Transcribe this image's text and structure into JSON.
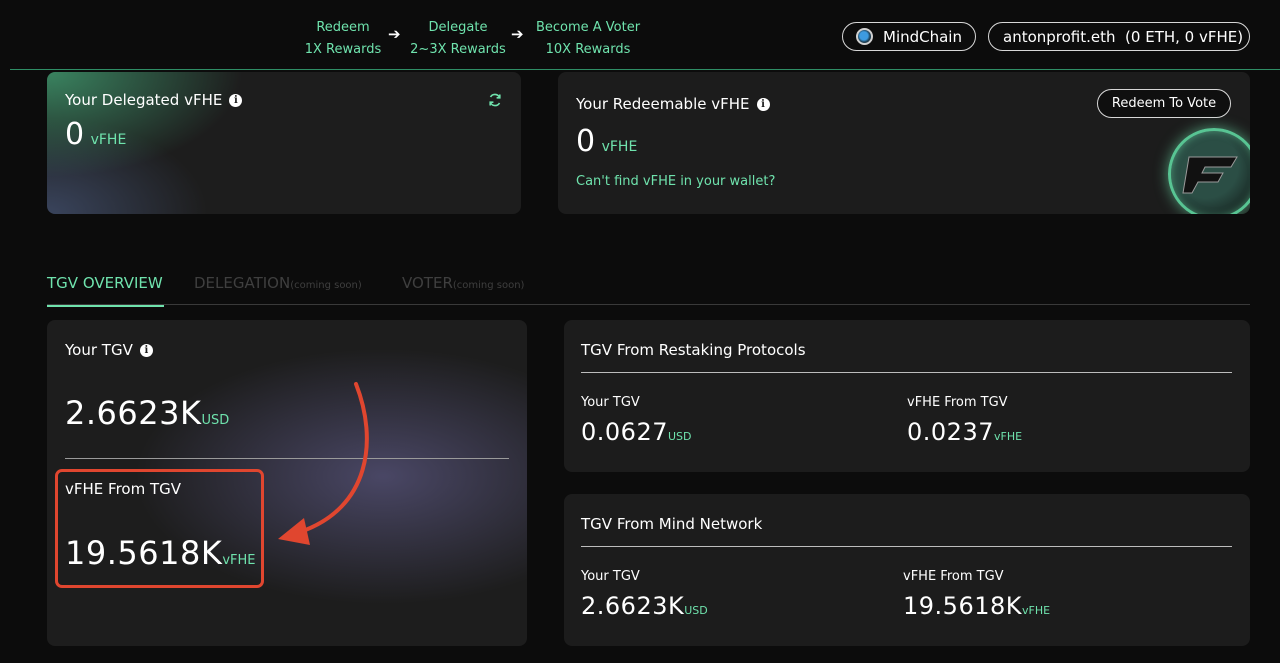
{
  "steps": [
    {
      "action": "Redeem",
      "reward": "1X Rewards"
    },
    {
      "action": "Delegate",
      "reward": "2~3X Rewards"
    },
    {
      "action": "Become A Voter",
      "reward": "10X Rewards"
    }
  ],
  "step_arrow_glyph": "➔",
  "network_button": {
    "label": "MindChain",
    "icon": "chain-logo-icon"
  },
  "wallet_button": {
    "label": "antonprofit.eth  (0 ETH, 0 vFHE)"
  },
  "delegated": {
    "title": "Your Delegated vFHE",
    "value": "0",
    "unit": "vFHE"
  },
  "redeemable": {
    "title": "Your Redeemable vFHE",
    "value": "0",
    "unit": "vFHE",
    "link": "Can't find vFHE in your wallet?",
    "button": "Redeem To Vote",
    "logo_icon": "fhe-coin-logo-icon"
  },
  "tabs": [
    {
      "label": "TGV OVERVIEW",
      "suffix": ""
    },
    {
      "label": "DELEGATION",
      "suffix": "(coming soon)"
    },
    {
      "label": "VOTER",
      "suffix": "(coming soon)"
    }
  ],
  "tgv_card": {
    "title": "Your TGV",
    "value": "2.6623K",
    "unit": "USD",
    "vfhe_label": "vFHE From TGV",
    "vfhe_value": "19.5618K",
    "vfhe_unit": "vFHE"
  },
  "restaking": {
    "title": "TGV From Restaking Protocols",
    "your_tgv_label": "Your TGV",
    "your_tgv_value": "0.0627",
    "your_tgv_unit": "USD",
    "vfhe_label": "vFHE From TGV",
    "vfhe_value": "0.0237",
    "vfhe_unit": "vFHE"
  },
  "mind_network": {
    "title": "TGV From Mind Network",
    "your_tgv_label": "Your TGV",
    "your_tgv_value": "2.6623K",
    "your_tgv_unit": "USD",
    "vfhe_label": "vFHE From TGV",
    "vfhe_value": "19.5618K",
    "vfhe_unit": "vFHE"
  },
  "colors": {
    "accent_green": "#6fe3ad",
    "annotation_red": "#e0462f",
    "background": "#0c0c0c",
    "card": "#1c1c1c"
  }
}
